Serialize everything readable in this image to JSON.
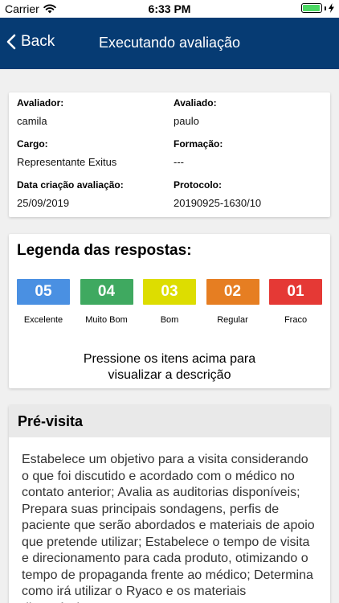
{
  "status_bar": {
    "carrier": "Carrier",
    "time": "6:33 PM",
    "battery_level": 0.95,
    "battery_color": "#4cd964"
  },
  "nav": {
    "back_label": "Back",
    "title": "Executando avaliação",
    "background_color": "#063b73"
  },
  "info": {
    "avaliador_label": "Avaliador:",
    "avaliador_value": "camila",
    "avaliado_label": "Avaliado:",
    "avaliado_value": "paulo",
    "cargo_label": "Cargo:",
    "cargo_value": "Representante Exitus",
    "formacao_label": "Formação:",
    "formacao_value": "---",
    "data_label": "Data criação avaliação:",
    "data_value": "25/09/2019",
    "protocolo_label": "Protocolo:",
    "protocolo_value": "20190925-1630/10"
  },
  "legend": {
    "title": "Legenda das respostas:",
    "items": [
      {
        "code": "05",
        "label": "Excelente",
        "color": "#4a90e2"
      },
      {
        "code": "04",
        "label": "Muito Bom",
        "color": "#3fa960"
      },
      {
        "code": "03",
        "label": "Bom",
        "color": "#dddd00"
      },
      {
        "code": "02",
        "label": "Regular",
        "color": "#e67e22"
      },
      {
        "code": "01",
        "label": "Fraco",
        "color": "#e53935"
      }
    ],
    "hint_line1": "Pressione os itens acima para",
    "hint_line2": "visualizar a descrição"
  },
  "section": {
    "title": "Pré-visita",
    "description": "Estabelece um objetivo para a visita considerando o que foi discutido e acordado com o médico no contato anterior; Avalia as auditorias disponíveis; Prepara suas principais sondagens, perfis de paciente que serão abordados e materiais de apoio que pretende utilizar; Estabelece o tempo de visita e direcionamento para cada produto, otimizando o tempo de propaganda frente ao médico; Determina como irá utilizar o Ryaco e os materiais disponíveis."
  }
}
